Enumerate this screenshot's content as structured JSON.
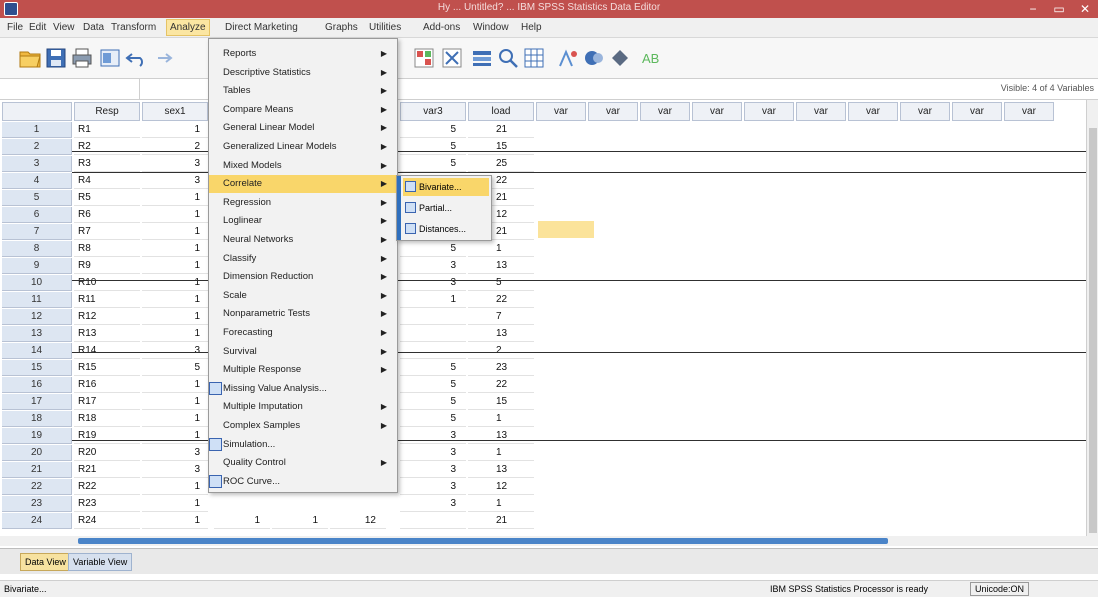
{
  "window": {
    "title": "Hy ... Untitled? ... IBM SPSS Statistics Data Editor",
    "minimize": "−",
    "maximize": "▭",
    "close": "✕"
  },
  "menubar": {
    "items": [
      "File",
      "Edit",
      "View",
      "Data",
      "Transform",
      "Analyze",
      "Direct Marketing",
      "Graphs",
      "Utilities",
      "Add-ons",
      "Window",
      "Help"
    ],
    "active": "Analyze"
  },
  "toolbar": {
    "icons": [
      "open-icon",
      "save-icon",
      "print-icon",
      "dialog-recall-icon",
      "undo-icon",
      "redo-icon",
      "goto-case-icon",
      "goto-variable-icon",
      "variables-icon",
      "find-icon",
      "insert-cases-icon",
      "insert-variable-icon",
      "split-file-icon",
      "weight-cases-icon",
      "select-cases-icon",
      "value-labels-icon",
      "use-sets-icon"
    ]
  },
  "cell_editor": {
    "visible_label": "Visible: 4 of 4 Variables"
  },
  "grid": {
    "headers": [
      "Resp",
      "sex1",
      "var3",
      "load",
      "var",
      "var",
      "var",
      "var",
      "var",
      "var",
      "var",
      "var",
      "var",
      "var"
    ],
    "rows": [
      {
        "n": "1",
        "resp": "R1",
        "sex": "1",
        "var3": "5",
        "load": "21"
      },
      {
        "n": "2",
        "resp": "R2",
        "sex": "2",
        "var3": "5",
        "load": "15"
      },
      {
        "n": "3",
        "resp": "R3",
        "sex": "3",
        "var3": "5",
        "load": "25"
      },
      {
        "n": "4",
        "resp": "R4",
        "sex": "3",
        "var3": "",
        "load": "22"
      },
      {
        "n": "5",
        "resp": "R5",
        "sex": "1",
        "var3": "",
        "load": "21"
      },
      {
        "n": "6",
        "resp": "R6",
        "sex": "1",
        "var3": "",
        "load": "12"
      },
      {
        "n": "7",
        "resp": "R7",
        "sex": "1",
        "var3": "",
        "load": "21"
      },
      {
        "n": "8",
        "resp": "R8",
        "sex": "1",
        "var3": "5",
        "load": "1"
      },
      {
        "n": "9",
        "resp": "R9",
        "sex": "1",
        "var3": "3",
        "load": "13"
      },
      {
        "n": "10",
        "resp": "R10",
        "sex": "1",
        "var3": "3",
        "load": "5"
      },
      {
        "n": "11",
        "resp": "R11",
        "sex": "1",
        "var3": "1",
        "load": "22"
      },
      {
        "n": "12",
        "resp": "R12",
        "sex": "1",
        "var3": "",
        "load": "7"
      },
      {
        "n": "13",
        "resp": "R13",
        "sex": "1",
        "var3": "",
        "load": "13"
      },
      {
        "n": "14",
        "resp": "R14",
        "sex": "3",
        "var3": "",
        "load": "2"
      },
      {
        "n": "15",
        "resp": "R15",
        "sex": "5",
        "var3": "5",
        "load": "23"
      },
      {
        "n": "16",
        "resp": "R16",
        "sex": "1",
        "var3": "5",
        "load": "22"
      },
      {
        "n": "17",
        "resp": "R17",
        "sex": "1",
        "var3": "5",
        "load": "15"
      },
      {
        "n": "18",
        "resp": "R18",
        "sex": "1",
        "var3": "5",
        "load": "1"
      },
      {
        "n": "19",
        "resp": "R19",
        "sex": "1",
        "var3": "3",
        "load": "13"
      },
      {
        "n": "20",
        "resp": "R20",
        "sex": "3",
        "var3": "3",
        "load": "1"
      },
      {
        "n": "21",
        "resp": "R21",
        "sex": "3",
        "var3": "3",
        "load": "13"
      },
      {
        "n": "22",
        "resp": "R22",
        "sex": "1",
        "var3": "3",
        "load": "12"
      },
      {
        "n": "23",
        "resp": "R23",
        "sex": "1",
        "var3": "3",
        "load": "1"
      },
      {
        "n": "24",
        "resp": "R24",
        "sex": "1",
        "var3": "",
        "load": "21"
      }
    ],
    "row24_extra": [
      "1",
      "1",
      "12"
    ]
  },
  "analyze_menu": {
    "items": [
      {
        "label": "Reports",
        "arrow": true
      },
      {
        "label": "Descriptive Statistics",
        "arrow": true
      },
      {
        "label": "Tables",
        "arrow": true
      },
      {
        "label": "Compare Means",
        "arrow": true
      },
      {
        "label": "General Linear Model",
        "arrow": true
      },
      {
        "label": "Generalized Linear Models",
        "arrow": true
      },
      {
        "label": "Mixed Models",
        "arrow": true
      },
      {
        "label": "Correlate",
        "arrow": true,
        "highlight": true
      },
      {
        "label": "Regression",
        "arrow": true
      },
      {
        "label": "Loglinear",
        "arrow": true
      },
      {
        "label": "Neural Networks",
        "arrow": true
      },
      {
        "label": "Classify",
        "arrow": true
      },
      {
        "label": "Dimension Reduction",
        "arrow": true
      },
      {
        "label": "Scale",
        "arrow": true
      },
      {
        "label": "Nonparametric Tests",
        "arrow": true
      },
      {
        "label": "Forecasting",
        "arrow": true
      },
      {
        "label": "Survival",
        "arrow": true
      },
      {
        "label": "Multiple Response",
        "arrow": true
      },
      {
        "label": "Missing Value Analysis...",
        "arrow": false,
        "icon": true
      },
      {
        "label": "Multiple Imputation",
        "arrow": true
      },
      {
        "label": "Complex Samples",
        "arrow": true
      },
      {
        "label": "Simulation...",
        "arrow": false,
        "icon": true
      },
      {
        "label": "Quality Control",
        "arrow": true
      },
      {
        "label": "ROC Curve...",
        "arrow": false,
        "icon": true
      }
    ]
  },
  "correlate_submenu": {
    "items": [
      "Bivariate...",
      "Partial...",
      "Distances..."
    ]
  },
  "tabs": {
    "data_view": "Data View",
    "variable_view": "Variable View"
  },
  "status": {
    "left": "Bivariate...",
    "processor": "IBM SPSS Statistics Processor is ready",
    "encoding": "Unicode:ON"
  },
  "colors": {
    "titlebar": "#c0504d",
    "highlight": "#f9d66a",
    "accent": "#2f6fbd"
  }
}
